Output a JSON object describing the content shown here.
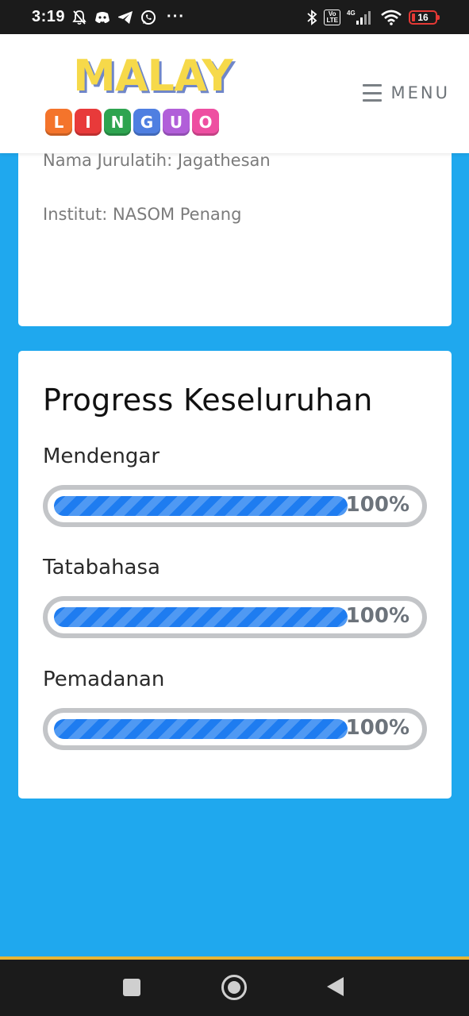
{
  "status_bar": {
    "time": "3:19",
    "left_icons": [
      "notifications-off-icon",
      "discord-icon",
      "telegram-icon",
      "whatsapp-icon"
    ],
    "more": "···",
    "right_icons": [
      "bluetooth-icon",
      "volte-icon",
      "signal-4g-icon",
      "wifi-icon",
      "battery-icon"
    ],
    "volte_label": "Vo\nLTE",
    "network_label": "4G",
    "battery_level": "16",
    "battery_color": "#e53935"
  },
  "header": {
    "logo_top": "MALAY",
    "logo_tiles": [
      {
        "letter": "L",
        "color": "#f4742b"
      },
      {
        "letter": "I",
        "color": "#e83a3a"
      },
      {
        "letter": "N",
        "color": "#2ea450"
      },
      {
        "letter": "G",
        "color": "#4f7fe1"
      },
      {
        "letter": "U",
        "color": "#b15fd9"
      },
      {
        "letter": "O",
        "color": "#ee4fa1"
      }
    ],
    "menu_label": "MENU"
  },
  "info_card": {
    "trainer": "Nama Jurulatih: Jagathesan",
    "institute": "Institut: NASOM Penang"
  },
  "progress_card": {
    "title": "Progress Keseluruhan",
    "skills": [
      {
        "label": "Mendengar",
        "progress": 1.0,
        "text": "100%"
      },
      {
        "label": "Tatabahasa",
        "progress": 1.0,
        "text": "100%"
      },
      {
        "label": "Pemadanan",
        "progress": 1.0,
        "text": "100%"
      }
    ]
  },
  "colors": {
    "background": "#1fa8ee",
    "bar_fill": "#1e7cf0",
    "bar_border": "#c3c5c8",
    "bar_text": "#6c737b"
  },
  "nav_bar": {
    "buttons": [
      "recents-square-icon",
      "home-circle-icon",
      "back-triangle-icon"
    ]
  }
}
